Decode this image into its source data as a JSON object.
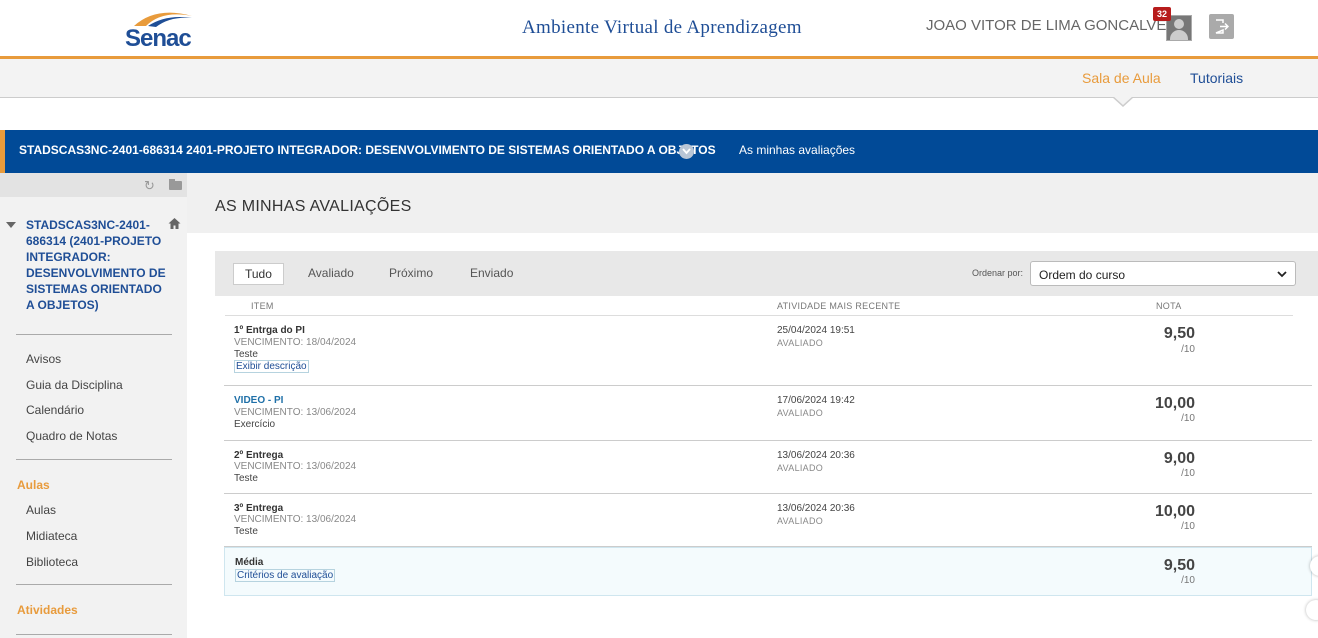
{
  "brand": {
    "logo_text": "Senac"
  },
  "header": {
    "title": "Ambiente Virtual de Aprendizagem",
    "user_name": "JOAO VITOR DE LIMA GONCALVES",
    "notification_count": "32"
  },
  "nav": {
    "sala_de_aula": "Sala de Aula",
    "tutoriais": "Tutoriais"
  },
  "course_bar": {
    "course_name": "STADSCAS3NC-2401-686314 2401-PROJETO INTEGRADOR: DESENVOLVIMENTO DE SISTEMAS ORIENTADO A OBJETOS",
    "breadcrumb": "As minhas avaliações"
  },
  "sidebar": {
    "course_title": "STADSCAS3NC-2401-686314 (2401-PROJETO INTEGRADOR: DESENVOLVIMENTO DE SISTEMAS ORIENTADO A OBJETOS)",
    "items_main": [
      "Avisos",
      "Guia da Disciplina",
      "Calendário",
      "Quadro de Notas"
    ],
    "section_aulas": "Aulas",
    "items_aulas": [
      "Aulas",
      "Midiateca",
      "Biblioteca"
    ],
    "section_atividades": "Atividades"
  },
  "page": {
    "title": "AS MINHAS AVALIAÇÕES"
  },
  "filters": {
    "tabs": [
      "Tudo",
      "Avaliado",
      "Próximo",
      "Enviado"
    ],
    "sort_label": "Ordenar por:",
    "sort_value": "Ordem do curso"
  },
  "columns": {
    "item": "ITEM",
    "activity": "ATIVIDADE MAIS RECENTE",
    "grade": "NOTA"
  },
  "rows": [
    {
      "title": "1º Entrga do PI",
      "due": "VENCIMENTO: 18/04/2024",
      "category": "Teste",
      "desc_link": "Exibir descrição",
      "date": "25/04/2024 19:51",
      "status": "AVALIADO",
      "grade": "9,50",
      "max": "/10"
    },
    {
      "title": "VIDEO - PI",
      "due": "VENCIMENTO: 13/06/2024",
      "category": "Exercício",
      "date": "17/06/2024 19:42",
      "status": "AVALIADO",
      "grade": "10,00",
      "max": "/10"
    },
    {
      "title": "2º Entrega",
      "due": "VENCIMENTO: 13/06/2024",
      "category": "Teste",
      "date": "13/06/2024 20:36",
      "status": "AVALIADO",
      "grade": "9,00",
      "max": "/10"
    },
    {
      "title": "3º Entrega",
      "due": "VENCIMENTO: 13/06/2024",
      "category": "Teste",
      "date": "13/06/2024 20:36",
      "status": "AVALIADO",
      "grade": "10,00",
      "max": "/10"
    }
  ],
  "average": {
    "title": "Média",
    "link": "Critérios de avaliação",
    "grade": "9,50",
    "max": "/10"
  },
  "colors": {
    "orange": "#e89b3c",
    "blue": "#014a97"
  }
}
